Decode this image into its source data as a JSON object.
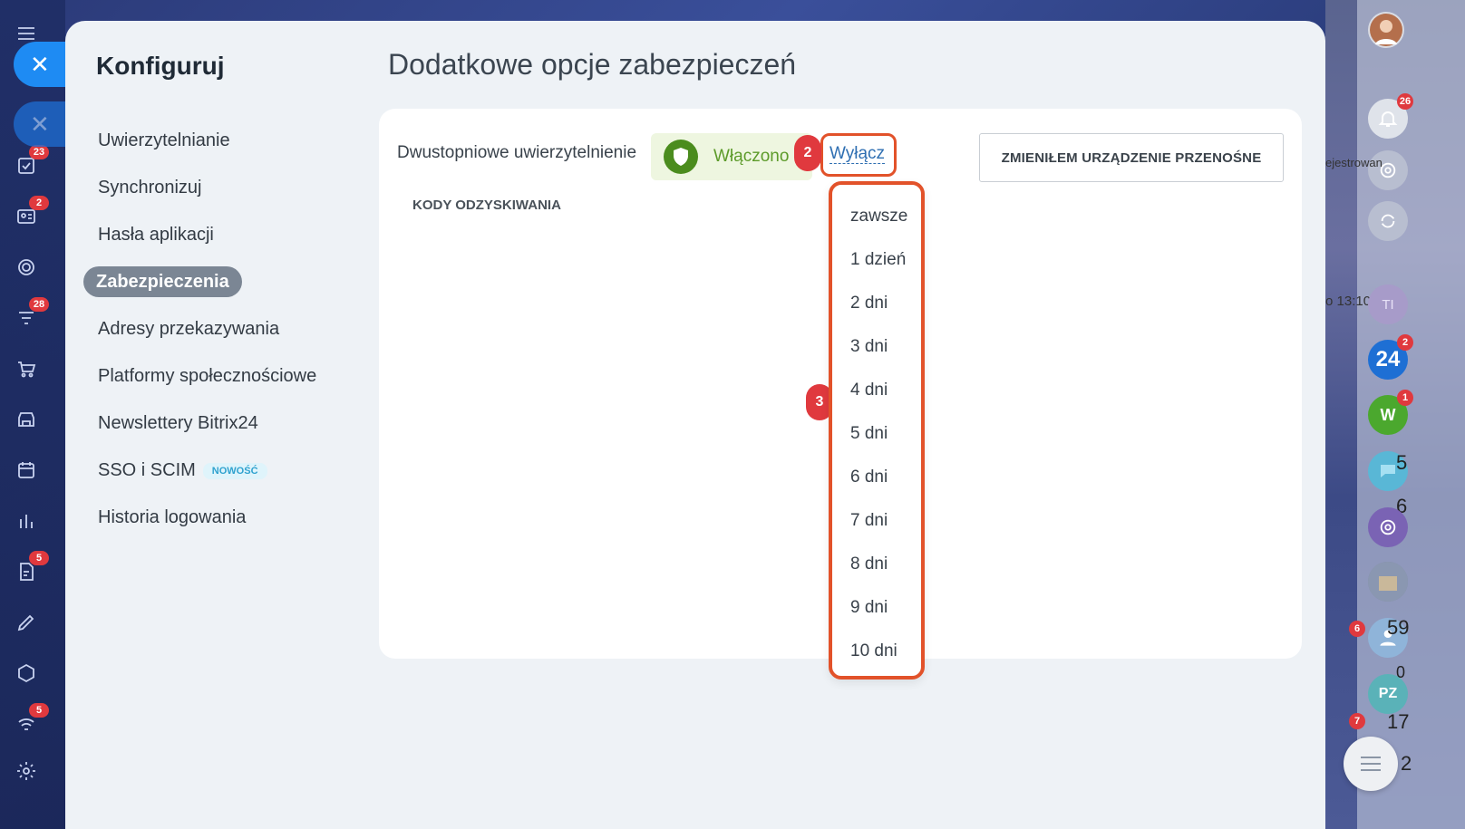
{
  "left_rail": {
    "badges": [
      "23",
      "2",
      "28",
      "5",
      "5"
    ]
  },
  "right_rail": {
    "badges": {
      "bell": "26",
      "b24": "2",
      "w": "1"
    },
    "avatar_initials": {
      "ti": "TI",
      "pz": "PZ",
      "w": "W",
      "b24": "24"
    },
    "side_numbers": [
      "5",
      "6",
      "59",
      "0",
      "17",
      "2"
    ],
    "small_badges": [
      "6",
      "7"
    ],
    "partial_texts": [
      "ejestrowan",
      "o 13:10"
    ]
  },
  "panel": {
    "title": "Konfiguruj",
    "nav": [
      {
        "label": "Uwierzytelnianie"
      },
      {
        "label": "Synchronizuj"
      },
      {
        "label": "Hasła aplikacji"
      },
      {
        "label": "Zabezpieczenia",
        "active": true
      },
      {
        "label": "Adresy przekazywania"
      },
      {
        "label": "Platformy społecznościowe"
      },
      {
        "label": "Newslettery Bitrix24"
      },
      {
        "label": "SSO i SCIM",
        "badge": "NOWOŚĆ"
      },
      {
        "label": "Historia logowania"
      }
    ]
  },
  "content": {
    "title": "Dodatkowe opcje zabezpieczeń",
    "two_factor_label": "Dwustopniowe uwierzytelnienie",
    "status_text": "Włączono",
    "disable_link": "Wyłącz",
    "change_device_button": "ZMIENIŁEM URZĄDZENIE PRZENOŚNE",
    "recovery_codes": "KODY ODZYSKIWANIA",
    "step_markers": {
      "two": "2",
      "three": "3"
    },
    "dropdown_options": [
      "zawsze",
      "1 dzień",
      "2 dni",
      "3 dni",
      "4 dni",
      "5 dni",
      "6 dni",
      "7 dni",
      "8 dni",
      "9 dni",
      "10 dni"
    ]
  },
  "colors": {
    "accent_blue": "#1e8bf3",
    "highlight_orange": "#e2522a",
    "badge_red": "#e0393e",
    "enabled_green": "#4b8c1e"
  }
}
